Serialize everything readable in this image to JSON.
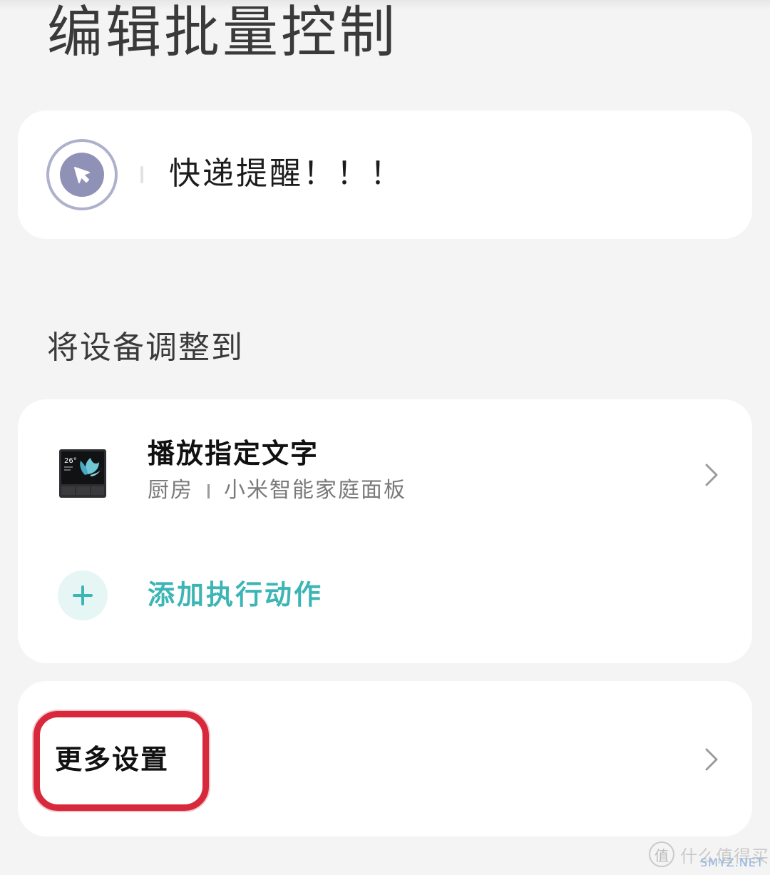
{
  "page": {
    "title": "编辑批量控制"
  },
  "scene": {
    "name": "快递提醒！！！",
    "icon": "cursor-click-icon",
    "icon_color": "#8f92b6"
  },
  "section": {
    "label": "将设备调整到"
  },
  "action": {
    "title": "播放指定文字",
    "room": "厨房",
    "device": "小米智能家庭面板",
    "device_icon": "smart-home-panel-icon",
    "thumb_temp": "26°"
  },
  "add_action": {
    "label": "添加执行动作",
    "color": "#3db5b5"
  },
  "more_settings": {
    "label": "更多设置",
    "highlight_color": "#d8283b"
  },
  "watermark": {
    "glyph": "值",
    "text": "什么值得买",
    "sub": "SMYZ.NET"
  }
}
